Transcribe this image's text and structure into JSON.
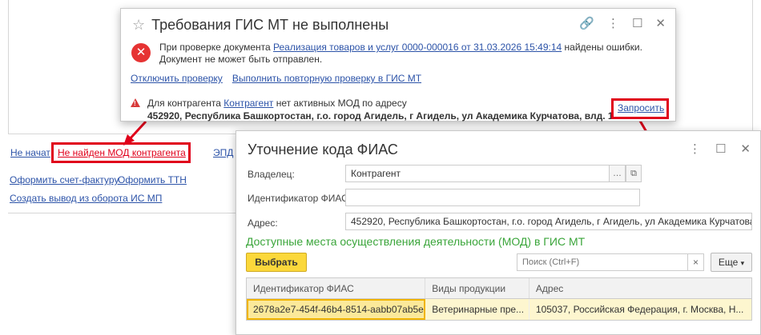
{
  "background": {
    "link_start": "Не начат",
    "link_mod": "Не найден МОД контрагента",
    "link_epd": "ЭПД",
    "link_invoice": "Оформить счет-фактуру",
    "link_ttn": "Оформить ТТН",
    "link_withdraw": "Создать вывод из оборота ИС МП"
  },
  "notify": {
    "title": "Требования ГИС МТ не выполнены",
    "text_before": "При проверке документа",
    "doc_link": "Реализация товаров и услуг 0000-000016 от 31.03.2026 15:49:14",
    "text_after": "найдены ошибки.",
    "line2": "Документ не может быть отправлен.",
    "link_disable": "Отключить проверку",
    "link_recheck": "Выполнить повторную проверку в ГИС МТ",
    "warn_prefix": "Для контрагента",
    "warn_link": "Контрагент",
    "warn_suffix": "нет активных МОД по адресу",
    "warn_address": "452920, Республика Башкортостан, г.о. город Агидель, г Агидель, ул Академика Курчатова, влд. 1",
    "request_link": "Запросить",
    "icons": [
      "star-icon",
      "link-icon",
      "more-icon",
      "close-icon"
    ]
  },
  "fias": {
    "title": "Уточнение кода ФИАС",
    "owner_label": "Владелец:",
    "owner_value": "Контрагент",
    "id_label": "Идентификатор ФИАС:",
    "id_value": "",
    "address_label": "Адрес:",
    "address_value": "452920, Республика Башкортостан, г.о. город Агидель, г Агидель, ул Академика Курчатова,",
    "section_title": "Доступные места осуществления деятельности (МОД) в ГИС МТ",
    "choose_button": "Выбрать",
    "search_placeholder": "Поиск (Ctrl+F)",
    "more_button": "Еще",
    "columns": [
      "Идентификатор ФИАС",
      "Виды продукции",
      "Адрес"
    ],
    "rows": [
      [
        "2678a2e7-454f-46b4-8514-aabb07ab5e...",
        "Ветеринарные пре...",
        "105037, Российская Федерация, г. Москва, Н..."
      ]
    ]
  },
  "colors": {
    "accent": "#2c53a8",
    "highlight": "#e0001b",
    "green": "#3aa53a",
    "yellow": "#fbd83b"
  }
}
